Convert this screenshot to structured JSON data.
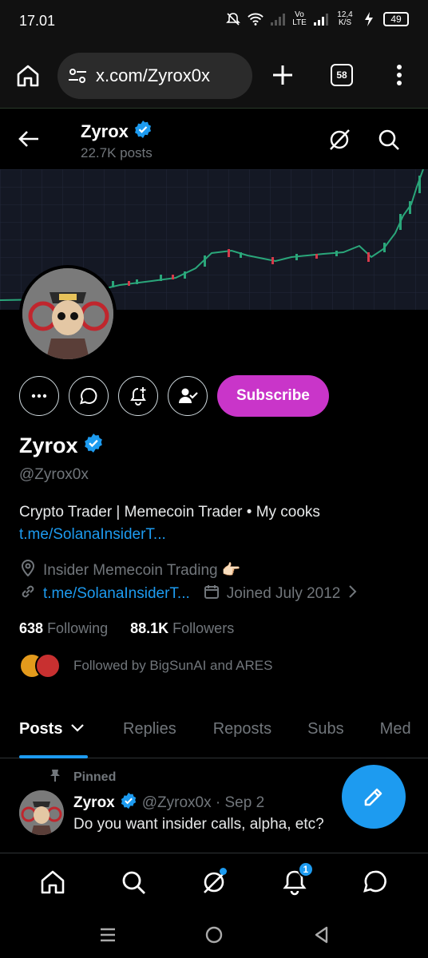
{
  "status_bar": {
    "time": "17.01",
    "network_label_top": "Vo",
    "network_label_bottom": "LTE",
    "speed_top": "12,4",
    "speed_bottom": "K/S",
    "battery": "49",
    "icons": [
      "mute-icon",
      "wifi-icon",
      "signal-icon",
      "signal-icon",
      "charging-icon",
      "battery-icon"
    ]
  },
  "browser": {
    "url": "x.com/Zyrox0x",
    "tab_count": "58"
  },
  "header": {
    "name": "Zyrox",
    "posts_count": "22.7K posts"
  },
  "profile": {
    "subscribe_label": "Subscribe",
    "name": "Zyrox",
    "handle": "@Zyrox0x",
    "bio_text": "Crypto Trader | Memecoin Trader • My cooks",
    "bio_link": "t.me/SolanaInsiderT...",
    "location": "Insider Memecoin Trading 👉🏻",
    "website": "t.me/SolanaInsiderT...",
    "joined": "Joined July 2012",
    "following_count": "638",
    "following_label": "Following",
    "followers_count": "88.1K",
    "followers_label": "Followers",
    "followed_by": "Followed by BigSunAI and ARES"
  },
  "tabs": [
    {
      "label": "Posts"
    },
    {
      "label": "Replies"
    },
    {
      "label": "Reposts"
    },
    {
      "label": "Subs"
    },
    {
      "label": "Med"
    }
  ],
  "pinned_post": {
    "pinned_label": "Pinned",
    "author": "Zyrox",
    "handle_time": "@Zyrox0x · Sep 2",
    "text": "Do you want insider calls, alpha, etc?"
  },
  "bottom_nav": {
    "notifications_badge": "1"
  },
  "colors": {
    "accent": "#1d9bf0",
    "subscribe": "#c935c9",
    "muted": "#71767b"
  }
}
